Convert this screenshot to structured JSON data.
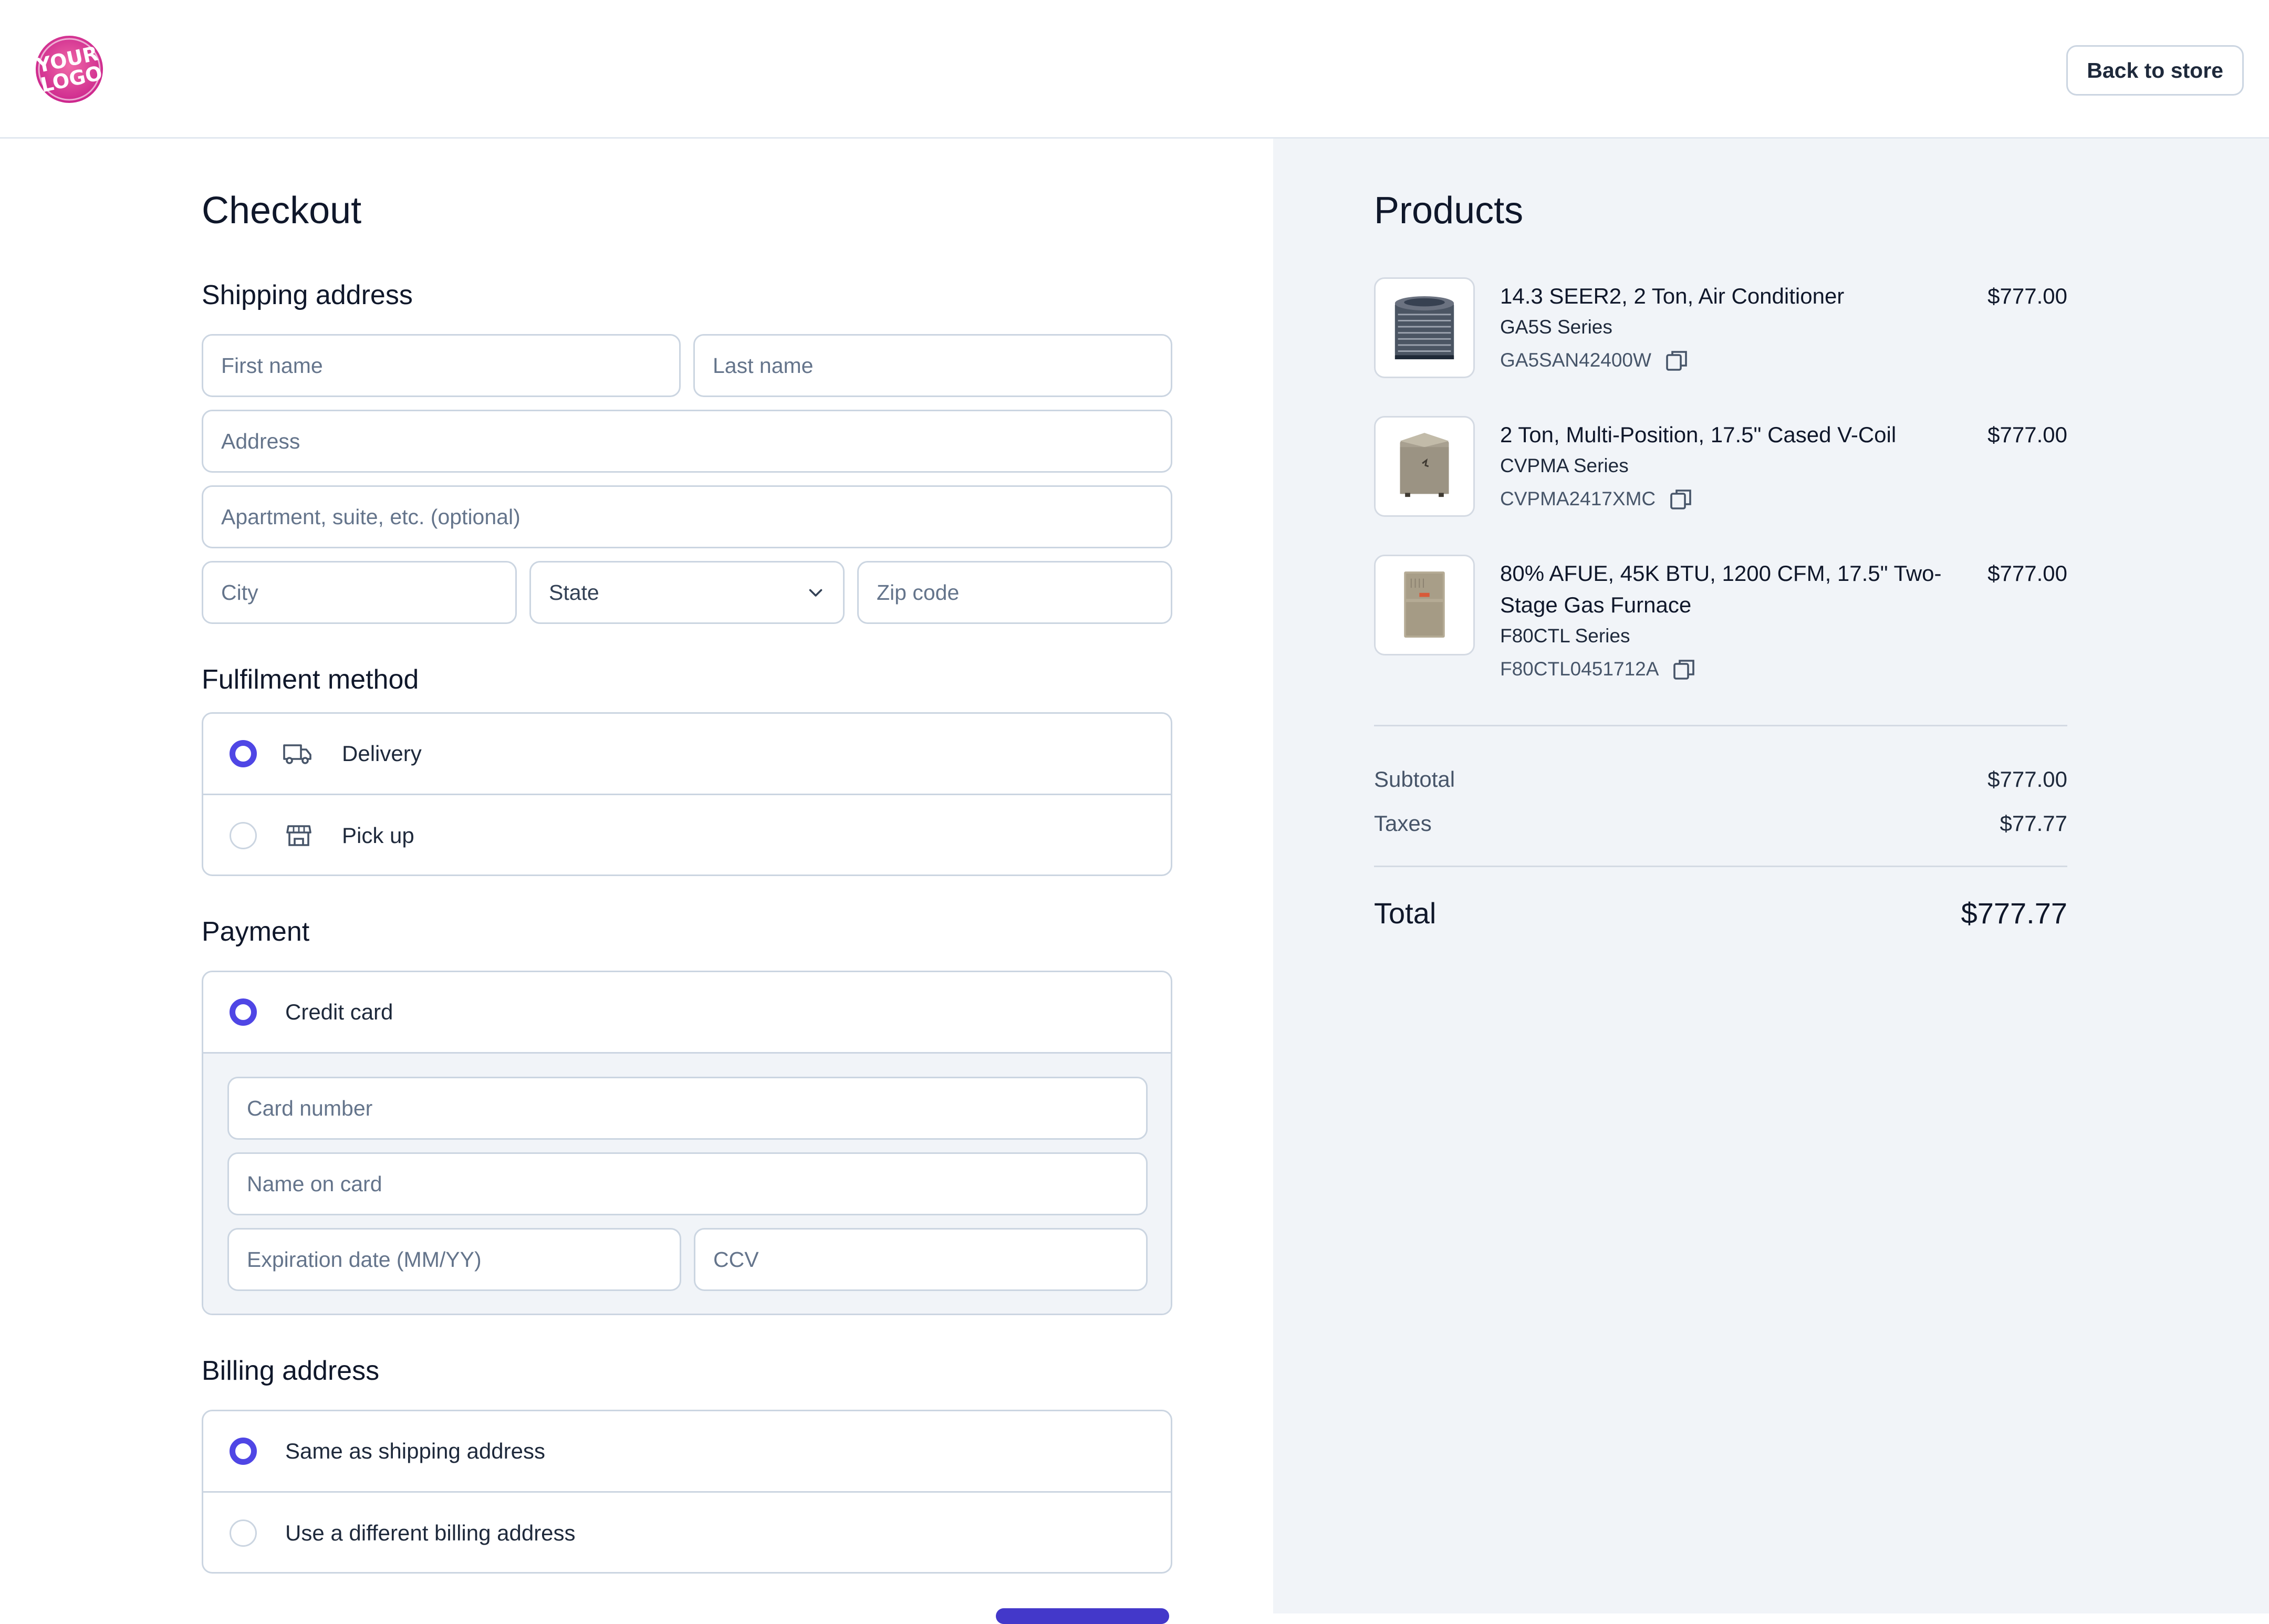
{
  "header": {
    "logo_text": "YOUR LOGO",
    "back_label": "Back to store"
  },
  "checkout": {
    "title": "Checkout",
    "shipping": {
      "heading": "Shipping address",
      "first_name_placeholder": "First name",
      "last_name_placeholder": "Last name",
      "address_placeholder": "Address",
      "apartment_placeholder": "Apartment, suite, etc. (optional)",
      "city_placeholder": "City",
      "state_label": "State",
      "zip_placeholder": "Zip code"
    },
    "fulfilment": {
      "heading": "Fulfilment method",
      "options": [
        {
          "label": "Delivery",
          "icon": "truck-icon",
          "selected": true
        },
        {
          "label": "Pick up",
          "icon": "store-icon",
          "selected": false
        }
      ]
    },
    "payment": {
      "heading": "Payment",
      "method_label": "Credit card",
      "card_number_placeholder": "Card number",
      "name_on_card_placeholder": "Name on card",
      "expiration_placeholder": "Expiration date (MM/YY)",
      "ccv_placeholder": "CCV"
    },
    "billing": {
      "heading": "Billing address",
      "options": [
        {
          "label": "Same as shipping address",
          "selected": true
        },
        {
          "label": "Use a different billing address",
          "selected": false
        }
      ]
    }
  },
  "summary": {
    "title": "Products",
    "products": [
      {
        "name": "14.3 SEER2, 2 Ton, Air Conditioner",
        "series": "GA5S Series",
        "sku": "GA5SAN42400W",
        "price": "$777.00"
      },
      {
        "name": "2 Ton, Multi-Position, 17.5\" Cased V-Coil",
        "series": "CVPMA Series",
        "sku": "CVPMA2417XMC",
        "price": "$777.00"
      },
      {
        "name": "80% AFUE, 45K BTU, 1200 CFM, 17.5\" Two-Stage Gas Furnace",
        "series": "F80CTL Series",
        "sku": "F80CTL0451712A",
        "price": "$777.00"
      }
    ],
    "subtotal_label": "Subtotal",
    "subtotal_value": "$777.00",
    "taxes_label": "Taxes",
    "taxes_value": "$77.77",
    "total_label": "Total",
    "total_value": "$777.77"
  },
  "colors": {
    "accent": "#4f46e5",
    "panel_bg": "#f1f4f8",
    "border": "#cbd5e1"
  }
}
